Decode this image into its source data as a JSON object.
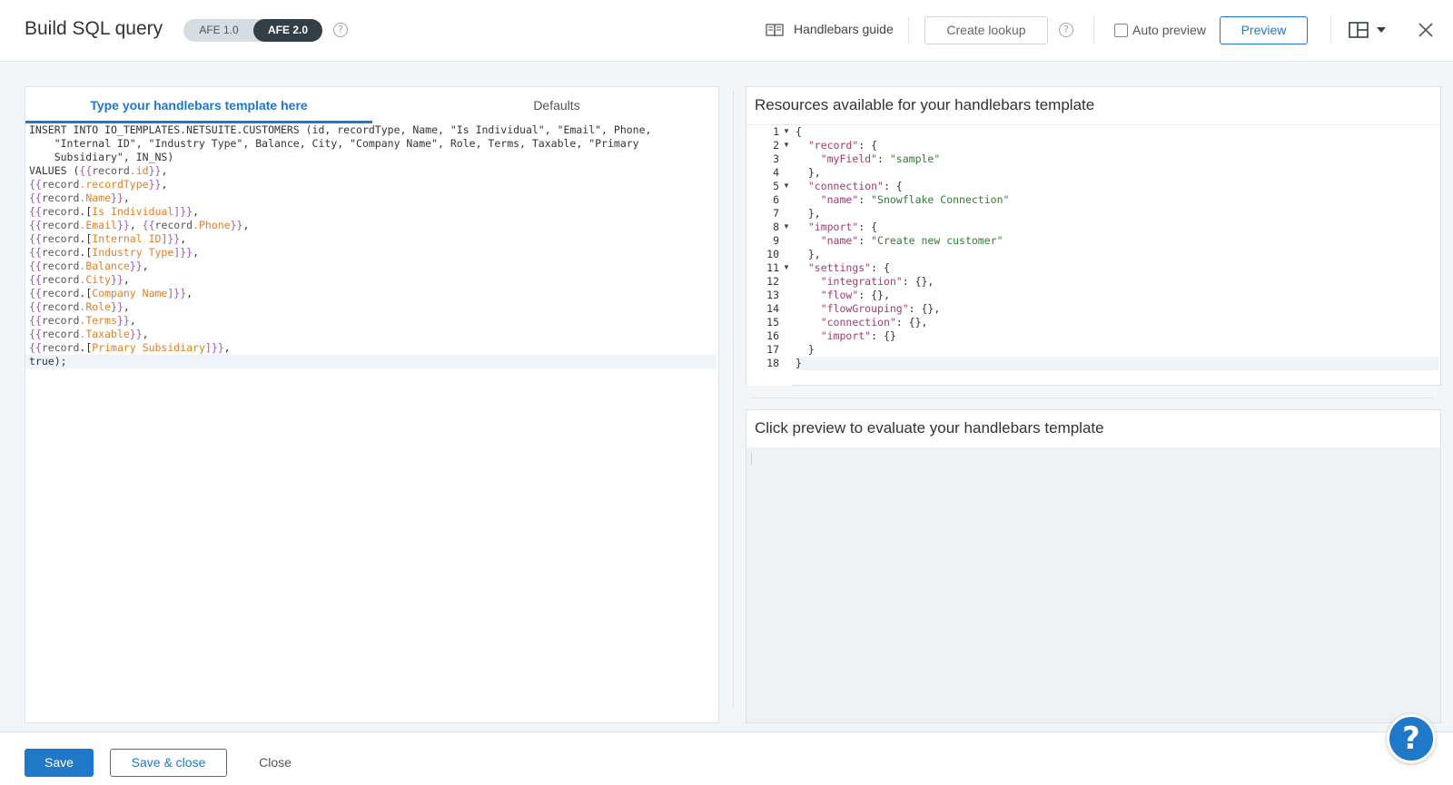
{
  "header": {
    "title": "Build SQL query",
    "afe_options": [
      "AFE 1.0",
      "AFE 2.0"
    ],
    "afe_selected": "AFE 2.0",
    "handlebars_guide": "Handlebars guide",
    "create_lookup": "Create lookup",
    "auto_preview": "Auto preview",
    "auto_preview_checked": false,
    "preview": "Preview",
    "help_glyph": "?"
  },
  "template_editor": {
    "tabs": [
      "Type your handlebars template here",
      "Defaults"
    ],
    "active_tab": "Type your handlebars template here",
    "lines": [
      [
        {
          "t": "INSERT INTO IO_TEMPLATES.NETSUITE.CUSTOMERS (id, recordType, Name, \"Is Individual\", \"Email\", Phone,",
          "c": "plain"
        }
      ],
      [
        {
          "t": "    \"Internal ID\", \"Industry Type\", Balance, City, \"Company Name\", Role, Terms, Taxable, \"Primary",
          "c": "plain"
        }
      ],
      [
        {
          "t": "    Subsidiary\", IN_NS)",
          "c": "plain"
        }
      ],
      [
        {
          "t": "VALUES (",
          "c": "plain"
        },
        {
          "t": "{{",
          "c": "brace"
        },
        {
          "t": "record",
          "c": "kw"
        },
        {
          "t": ".id",
          "c": "path"
        },
        {
          "t": "}}",
          "c": "brace"
        },
        {
          "t": ",",
          "c": "plain"
        }
      ],
      [
        {
          "t": "{{",
          "c": "brace"
        },
        {
          "t": "record",
          "c": "kw"
        },
        {
          "t": ".recordType",
          "c": "path"
        },
        {
          "t": "}}",
          "c": "brace"
        },
        {
          "t": ",",
          "c": "plain"
        }
      ],
      [
        {
          "t": "{{",
          "c": "brace"
        },
        {
          "t": "record",
          "c": "kw"
        },
        {
          "t": ".Name",
          "c": "path"
        },
        {
          "t": "}}",
          "c": "brace"
        },
        {
          "t": ",",
          "c": "plain"
        }
      ],
      [
        {
          "t": "{{",
          "c": "brace"
        },
        {
          "t": "record",
          "c": "kw"
        },
        {
          "t": ".[",
          "c": "plain"
        },
        {
          "t": "Is Individual",
          "c": "path"
        },
        {
          "t": "]}}",
          "c": "brace"
        },
        {
          "t": ",",
          "c": "plain"
        }
      ],
      [
        {
          "t": "{{",
          "c": "brace"
        },
        {
          "t": "record",
          "c": "kw"
        },
        {
          "t": ".Email",
          "c": "path"
        },
        {
          "t": "}}",
          "c": "brace"
        },
        {
          "t": ", ",
          "c": "plain"
        },
        {
          "t": "{{",
          "c": "brace"
        },
        {
          "t": "record",
          "c": "kw"
        },
        {
          "t": ".Phone",
          "c": "path"
        },
        {
          "t": "}}",
          "c": "brace"
        },
        {
          "t": ",",
          "c": "plain"
        }
      ],
      [
        {
          "t": "{{",
          "c": "brace"
        },
        {
          "t": "record",
          "c": "kw"
        },
        {
          "t": ".[",
          "c": "plain"
        },
        {
          "t": "Internal ID",
          "c": "path"
        },
        {
          "t": "]}}",
          "c": "brace"
        },
        {
          "t": ",",
          "c": "plain"
        }
      ],
      [
        {
          "t": "{{",
          "c": "brace"
        },
        {
          "t": "record",
          "c": "kw"
        },
        {
          "t": ".[",
          "c": "plain"
        },
        {
          "t": "Industry Type",
          "c": "path"
        },
        {
          "t": "]}}",
          "c": "brace"
        },
        {
          "t": ",",
          "c": "plain"
        }
      ],
      [
        {
          "t": "{{",
          "c": "brace"
        },
        {
          "t": "record",
          "c": "kw"
        },
        {
          "t": ".Balance",
          "c": "path"
        },
        {
          "t": "}}",
          "c": "brace"
        },
        {
          "t": ",",
          "c": "plain"
        }
      ],
      [
        {
          "t": "{{",
          "c": "brace"
        },
        {
          "t": "record",
          "c": "kw"
        },
        {
          "t": ".City",
          "c": "path"
        },
        {
          "t": "}}",
          "c": "brace"
        },
        {
          "t": ",",
          "c": "plain"
        }
      ],
      [
        {
          "t": "{{",
          "c": "brace"
        },
        {
          "t": "record",
          "c": "kw"
        },
        {
          "t": ".[",
          "c": "plain"
        },
        {
          "t": "Company Name",
          "c": "path"
        },
        {
          "t": "]}}",
          "c": "brace"
        },
        {
          "t": ",",
          "c": "plain"
        }
      ],
      [
        {
          "t": "{{",
          "c": "brace"
        },
        {
          "t": "record",
          "c": "kw"
        },
        {
          "t": ".Role",
          "c": "path"
        },
        {
          "t": "}}",
          "c": "brace"
        },
        {
          "t": ",",
          "c": "plain"
        }
      ],
      [
        {
          "t": "{{",
          "c": "brace"
        },
        {
          "t": "record",
          "c": "kw"
        },
        {
          "t": ".Terms",
          "c": "path"
        },
        {
          "t": "}}",
          "c": "brace"
        },
        {
          "t": ",",
          "c": "plain"
        }
      ],
      [
        {
          "t": "{{",
          "c": "brace"
        },
        {
          "t": "record",
          "c": "kw"
        },
        {
          "t": ".Taxable",
          "c": "path"
        },
        {
          "t": "}}",
          "c": "brace"
        },
        {
          "t": ",",
          "c": "plain"
        }
      ],
      [
        {
          "t": "{{",
          "c": "brace"
        },
        {
          "t": "record",
          "c": "kw"
        },
        {
          "t": ".[",
          "c": "plain"
        },
        {
          "t": "Primary Subsidiary",
          "c": "path"
        },
        {
          "t": "]}}",
          "c": "brace"
        },
        {
          "t": ",",
          "c": "plain"
        }
      ],
      [
        {
          "t": "true);",
          "c": "plain"
        }
      ]
    ],
    "active_line": 17
  },
  "resources": {
    "title": "Resources available for your handlebars template",
    "fold_lines": [
      1,
      2,
      5,
      8,
      11
    ],
    "active_line": 18,
    "lines": [
      [
        {
          "t": "{",
          "c": "p"
        }
      ],
      [
        {
          "t": "  ",
          "c": "p"
        },
        {
          "t": "\"record\"",
          "c": "k"
        },
        {
          "t": ": {",
          "c": "p"
        }
      ],
      [
        {
          "t": "    ",
          "c": "p"
        },
        {
          "t": "\"myField\"",
          "c": "k"
        },
        {
          "t": ": ",
          "c": "p"
        },
        {
          "t": "\"sample\"",
          "c": "s"
        }
      ],
      [
        {
          "t": "  },",
          "c": "p"
        }
      ],
      [
        {
          "t": "  ",
          "c": "p"
        },
        {
          "t": "\"connection\"",
          "c": "k"
        },
        {
          "t": ": {",
          "c": "p"
        }
      ],
      [
        {
          "t": "    ",
          "c": "p"
        },
        {
          "t": "\"name\"",
          "c": "k"
        },
        {
          "t": ": ",
          "c": "p"
        },
        {
          "t": "\"Snowflake Connection\"",
          "c": "s"
        }
      ],
      [
        {
          "t": "  },",
          "c": "p"
        }
      ],
      [
        {
          "t": "  ",
          "c": "p"
        },
        {
          "t": "\"import\"",
          "c": "k"
        },
        {
          "t": ": {",
          "c": "p"
        }
      ],
      [
        {
          "t": "    ",
          "c": "p"
        },
        {
          "t": "\"name\"",
          "c": "k"
        },
        {
          "t": ": ",
          "c": "p"
        },
        {
          "t": "\"Create new customer\"",
          "c": "s"
        }
      ],
      [
        {
          "t": "  },",
          "c": "p"
        }
      ],
      [
        {
          "t": "  ",
          "c": "p"
        },
        {
          "t": "\"settings\"",
          "c": "k"
        },
        {
          "t": ": {",
          "c": "p"
        }
      ],
      [
        {
          "t": "    ",
          "c": "p"
        },
        {
          "t": "\"integration\"",
          "c": "k"
        },
        {
          "t": ": {},",
          "c": "p"
        }
      ],
      [
        {
          "t": "    ",
          "c": "p"
        },
        {
          "t": "\"flow\"",
          "c": "k"
        },
        {
          "t": ": {},",
          "c": "p"
        }
      ],
      [
        {
          "t": "    ",
          "c": "p"
        },
        {
          "t": "\"flowGrouping\"",
          "c": "k"
        },
        {
          "t": ": {},",
          "c": "p"
        }
      ],
      [
        {
          "t": "    ",
          "c": "p"
        },
        {
          "t": "\"connection\"",
          "c": "k"
        },
        {
          "t": ": {},",
          "c": "p"
        }
      ],
      [
        {
          "t": "    ",
          "c": "p"
        },
        {
          "t": "\"import\"",
          "c": "k"
        },
        {
          "t": ": {}",
          "c": "p"
        }
      ],
      [
        {
          "t": "  }",
          "c": "p"
        }
      ],
      [
        {
          "t": "}",
          "c": "p"
        }
      ]
    ]
  },
  "preview_panel": {
    "title": "Click preview to evaluate your handlebars template"
  },
  "footer": {
    "save": "Save",
    "save_close": "Save & close",
    "close": "Close"
  },
  "help_fab": "?",
  "colors": {
    "accent": "#1f78c8",
    "toggle_selected": "#333f48",
    "hb_brace": "#9b59b6",
    "hb_path": "#e67e22",
    "json_key": "#a23b72",
    "json_string": "#2f7d32"
  }
}
